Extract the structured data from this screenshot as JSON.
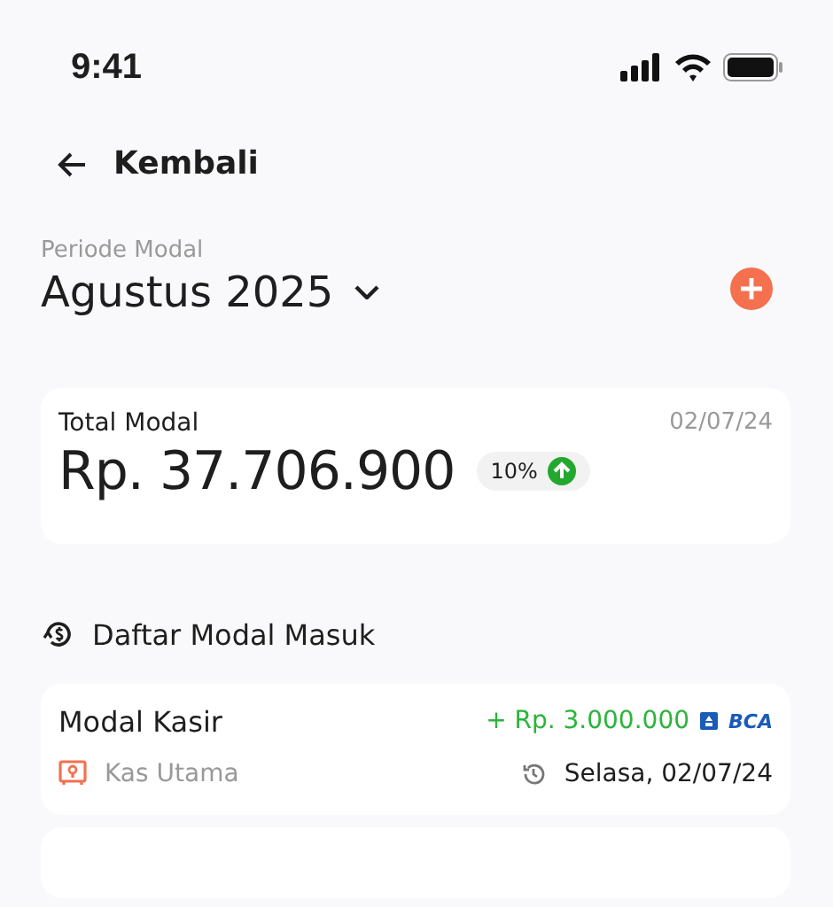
{
  "status_bar": {
    "time": "9:41"
  },
  "header": {
    "back_label": "Kembali"
  },
  "period": {
    "label": "Periode Modal",
    "value": "Agustus 2025"
  },
  "summary": {
    "title": "Total Modal",
    "date": "02/07/24",
    "amount": "Rp. 37.706.900",
    "change": "10%",
    "rising": true
  },
  "section": {
    "title": "Daftar Modal Masuk"
  },
  "entries": [
    {
      "title": "Modal Kasir",
      "amount": "+ Rp. 3.000.000",
      "bank": "BCA",
      "location": "Kas Utama",
      "date": "Selasa, 02/07/24"
    }
  ]
}
